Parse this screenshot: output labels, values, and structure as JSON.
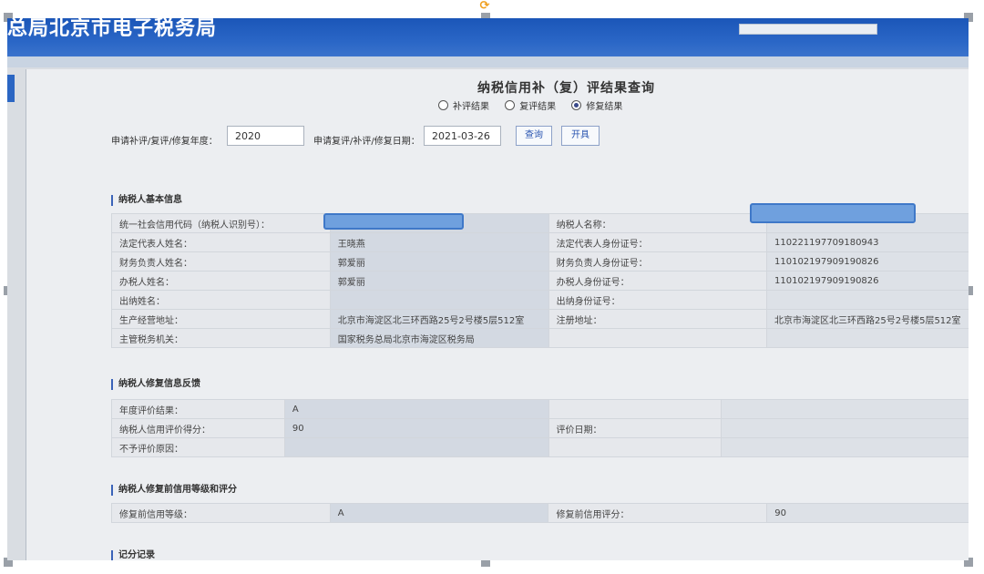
{
  "header": {
    "site_title": "总局北京市电子税务局"
  },
  "page": {
    "title": "纳税信用补（复）评结果查询",
    "radios": [
      {
        "label": "补评结果",
        "checked": false
      },
      {
        "label": "复评结果",
        "checked": false
      },
      {
        "label": "修复结果",
        "checked": true
      }
    ],
    "filters": {
      "year_label": "申请补评/复评/修复年度：",
      "year_value": "2020",
      "date_label": "申请复评/补评/修复日期：",
      "date_value": "2021-03-26",
      "query_button": "查询",
      "print_button": "开具"
    }
  },
  "basic_info": {
    "heading": "纳税人基本信息",
    "rows": [
      {
        "k1": "统一社会信用代码（纳税人识别号）：",
        "v1": "",
        "k2": "纳税人名称：",
        "v2": ""
      },
      {
        "k1": "法定代表人姓名：",
        "v1": "王晓燕",
        "k2": "法定代表人身份证号：",
        "v2": "110221197709180943"
      },
      {
        "k1": "财务负责人姓名：",
        "v1": "郭爱丽",
        "k2": "财务负责人身份证号：",
        "v2": "110102197909190826"
      },
      {
        "k1": "办税人姓名：",
        "v1": "郭爱丽",
        "k2": "办税人身份证号：",
        "v2": "110102197909190826"
      },
      {
        "k1": "出纳姓名：",
        "v1": "",
        "k2": "出纳身份证号：",
        "v2": ""
      },
      {
        "k1": "生产经营地址：",
        "v1": "北京市海淀区北三环西路25号2号楼5层512室",
        "k2": "注册地址：",
        "v2": "北京市海淀区北三环西路25号2号楼5层512室"
      },
      {
        "k1": "主管税务机关：",
        "v1": "国家税务总局北京市海淀区税务局",
        "k2": "",
        "v2": ""
      }
    ]
  },
  "repair_feedback": {
    "heading": "纳税人修复信息反馈",
    "rows": [
      {
        "k1": "年度评价结果：",
        "v1": "A",
        "k2": "",
        "v2": ""
      },
      {
        "k1": "纳税人信用评价得分：",
        "v1": "90",
        "k2": "评价日期：",
        "v2": ""
      },
      {
        "k1": "不予评价原因：",
        "v1": "",
        "k2": "",
        "v2": ""
      }
    ]
  },
  "before_repair": {
    "heading": "纳税人修复前信用等级和评分",
    "rows": [
      {
        "k1": "修复前信用等级：",
        "v1": "A",
        "k2": "修复前信用评分：",
        "v2": "90"
      }
    ]
  },
  "score_record": {
    "heading": "记分记录"
  },
  "colors": {
    "header_blue": "#1b56b8",
    "redaction_blue": "#6fa0de",
    "accent_orange": "#f0a020"
  }
}
